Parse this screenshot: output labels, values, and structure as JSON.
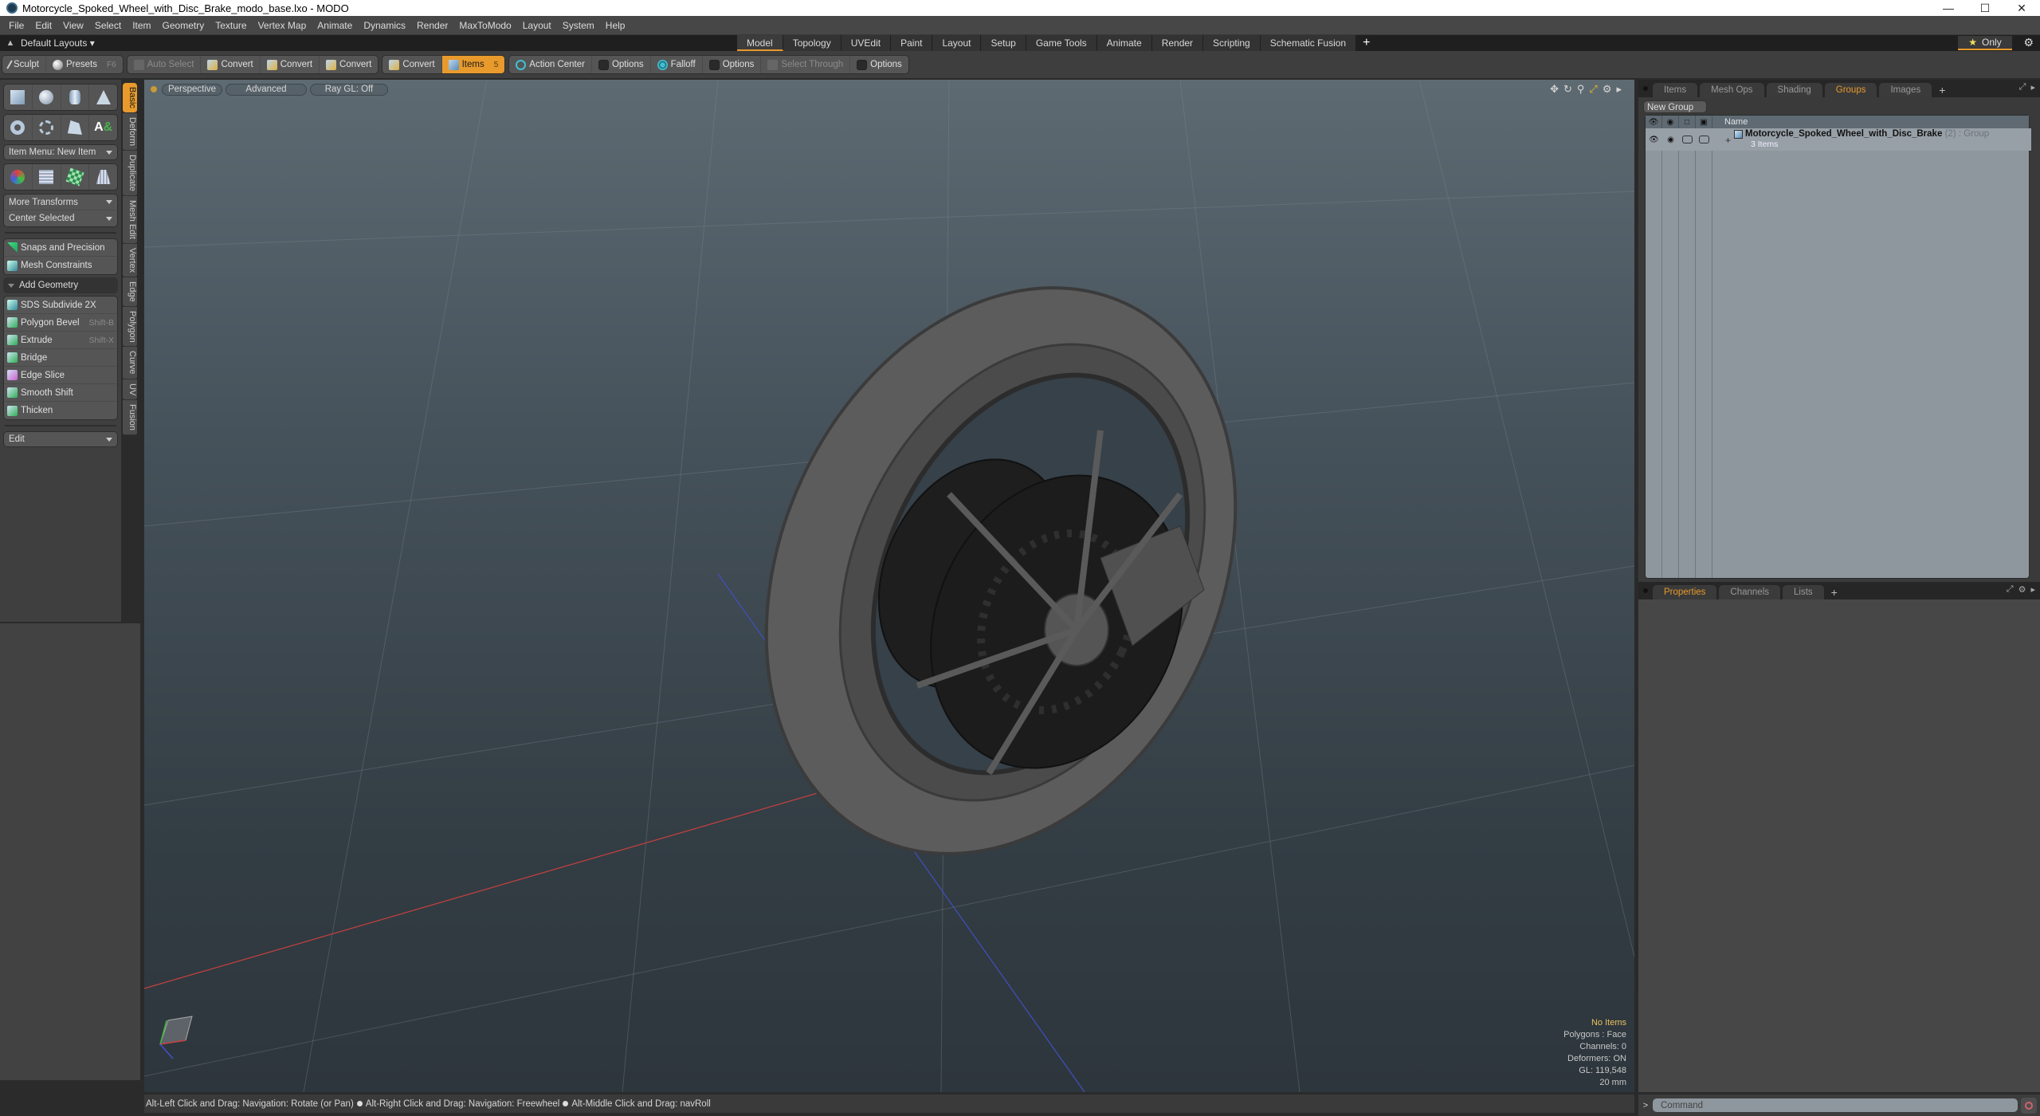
{
  "window": {
    "title": "Motorcycle_Spoked_Wheel_with_Disc_Brake_modo_base.lxo - MODO",
    "controls": [
      "minimize",
      "maximize",
      "close"
    ]
  },
  "menubar": {
    "items": [
      "File",
      "Edit",
      "View",
      "Select",
      "Item",
      "Geometry",
      "Texture",
      "Vertex Map",
      "Animate",
      "Dynamics",
      "Render",
      "MaxToModo",
      "Layout",
      "System",
      "Help"
    ]
  },
  "layoutbar": {
    "layout_select": "Default Layouts ▾",
    "tabs": [
      "Model",
      "Topology",
      "UVEdit",
      "Paint",
      "Layout",
      "Setup",
      "Game Tools",
      "Animate",
      "Render",
      "Scripting",
      "Schematic Fusion"
    ],
    "active_tab": "Model",
    "add_tab": "+",
    "only_label": "Only"
  },
  "toolbar": {
    "sculpt": "Sculpt",
    "presets": "Presets",
    "presets_shortcut": "F6",
    "auto_select": "Auto Select",
    "convert": [
      "Convert",
      "Convert",
      "Convert",
      "Convert"
    ],
    "items": "Items",
    "items_shortcut": "5",
    "action_center": "Action Center",
    "options_1": "Options",
    "falloff": "Falloff",
    "options_2": "Options",
    "select_through": "Select Through",
    "options_3": "Options"
  },
  "toolbox": {
    "item_menu": "Item Menu: New Item",
    "more_transforms": "More Transforms",
    "center_selected": "Center Selected",
    "snaps": "Snaps and Precision",
    "mesh_constraints": "Mesh Constraints",
    "add_geometry": "Add Geometry",
    "geometry_tools": [
      {
        "label": "SDS Subdivide 2X",
        "shortcut": ""
      },
      {
        "label": "Polygon Bevel",
        "shortcut": "Shift-B"
      },
      {
        "label": "Extrude",
        "shortcut": "Shift-X"
      },
      {
        "label": "Bridge",
        "shortcut": ""
      },
      {
        "label": "Edge Slice",
        "shortcut": ""
      },
      {
        "label": "Smooth Shift",
        "shortcut": ""
      },
      {
        "label": "Thicken",
        "shortcut": ""
      }
    ],
    "edit_dropdown": "Edit"
  },
  "vtabs": [
    "Basic",
    "Deform",
    "Duplicate",
    "Mesh Edit",
    "Vertex",
    "Edge",
    "Polygon",
    "Curve",
    "UV",
    "Fusion"
  ],
  "viewport": {
    "view_mode": "Perspective",
    "shading": "Advanced",
    "raygl": "Ray GL: Off",
    "stats": {
      "selection": "No Items",
      "polygons": "Polygons : Face",
      "channels": "Channels: 0",
      "deformers": "Deformers: ON",
      "gl": "GL: 119,548",
      "grid": "20 mm"
    }
  },
  "statusbar": {
    "hints": [
      "Alt-Left Click and Drag: Navigation: Rotate (or Pan)",
      "Alt-Right Click and Drag: Navigation: Freewheel",
      "Alt-Middle Click and Drag: navRoll"
    ]
  },
  "groups_panel": {
    "tabs": [
      "Items",
      "Mesh Ops",
      "Shading",
      "Groups",
      "Images"
    ],
    "active_tab": "Groups",
    "new_group": "New Group",
    "column_name": "Name",
    "rows": [
      {
        "name": "Motorcycle_Spoked_Wheel_with_Disc_Brake",
        "count": "(2)",
        "type": ": Group",
        "sub": "3 Items"
      }
    ]
  },
  "properties_panel": {
    "tabs": [
      "Properties",
      "Channels",
      "Lists"
    ],
    "active_tab": "Properties"
  },
  "command": {
    "prompt": ">",
    "placeholder": "Command"
  },
  "colors": {
    "accent": "#e89a2c",
    "panel": "#3f3f3f",
    "tree_bg": "#8f979e"
  }
}
